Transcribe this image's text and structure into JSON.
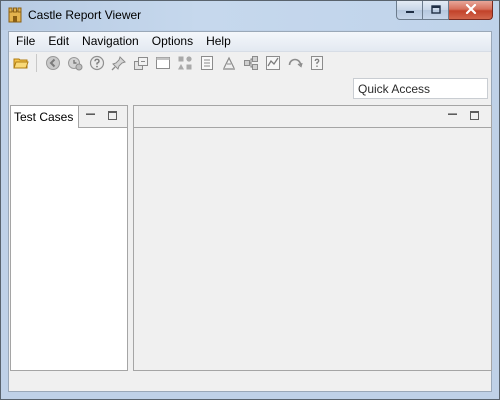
{
  "window": {
    "title": "Castle Report Viewer",
    "controls": {
      "minimize": "minimize-icon",
      "maximize": "maximize-icon",
      "close": "close-icon"
    }
  },
  "menubar": {
    "items": [
      "File",
      "Edit",
      "Navigation",
      "Options",
      "Help"
    ]
  },
  "toolbar": {
    "icons": [
      "open-folder-icon",
      "back-icon",
      "history-icon",
      "question-icon",
      "pin-icon",
      "export-icon",
      "window-icon",
      "shapes-icon",
      "list-icon",
      "graph-icon",
      "flow-icon",
      "chart-icon",
      "refresh-icon",
      "help-icon"
    ]
  },
  "quick_access": {
    "placeholder": "Quick Access"
  },
  "views": {
    "left": {
      "tab_label": "Test Cases"
    }
  },
  "colors": {
    "title_bar": "#bfd3ea",
    "close_button": "#c8452c",
    "client_background": "#f0f0f0"
  }
}
